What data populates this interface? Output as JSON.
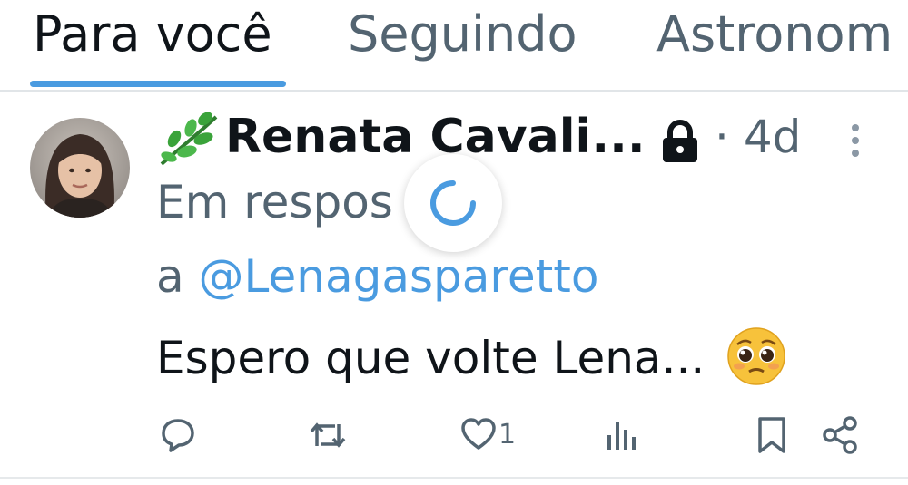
{
  "tabs": [
    {
      "label": "Para você",
      "active": true
    },
    {
      "label": "Seguindo",
      "active": false
    },
    {
      "label": "Astronom",
      "active": false
    }
  ],
  "tweet": {
    "author_name": "Renata Cavali...",
    "author_emoji_icon": "herb-leaf-icon",
    "protected_icon": "lock-icon",
    "separator": "·",
    "time": "4d",
    "reply_prefix": "Em respos",
    "reply_to_word": "a",
    "reply_mention": "@Lenagasparetto",
    "text": "Espero que volte Lena...",
    "text_emoji_icon": "pleading-face-icon",
    "actions": {
      "reply_icon": "comment-icon",
      "retweet_icon": "retweet-icon",
      "like_icon": "heart-icon",
      "like_count": "1",
      "views_icon": "analytics-icon",
      "bookmark_icon": "bookmark-icon",
      "share_icon": "share-icon"
    }
  },
  "loading_indicator": "spinner-icon",
  "colors": {
    "accent": "#4a9be0",
    "text_primary": "#0f1419",
    "text_secondary": "#536471",
    "leaf_green": "#3aa33a"
  }
}
